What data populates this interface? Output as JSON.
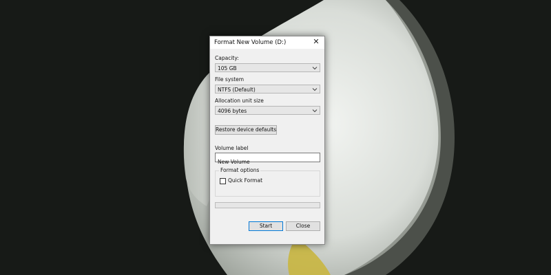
{
  "dialog": {
    "title": "Format New Volume (D:)",
    "close_icon": "close-icon",
    "capacity": {
      "label": "Capacity:",
      "value": "105 GB"
    },
    "file_system": {
      "label": "File system",
      "value": "NTFS (Default)"
    },
    "allocation_unit_size": {
      "label": "Allocation unit size",
      "value": "4096 bytes"
    },
    "restore_defaults_label": "Restore device defaults",
    "volume_label": {
      "label": "Volume label",
      "value": "New Volume"
    },
    "format_options": {
      "legend": "Format options",
      "quick_format_label": "Quick Format",
      "quick_format_checked": false
    },
    "progress": 0,
    "start_label": "Start",
    "close_label": "Close"
  },
  "colors": {
    "wallpaper_dark": "#171a17",
    "flower_light": "#e8ebe7",
    "flower_shadow": "#9ea39c",
    "flower_yellow": "#c9b640",
    "default_button_border": "#0078d7"
  }
}
